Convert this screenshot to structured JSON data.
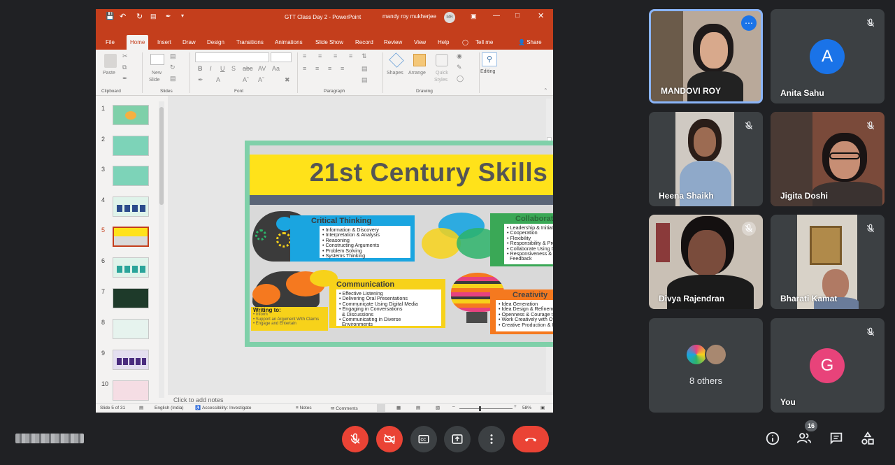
{
  "powerpoint": {
    "title": "GTT Class Day 2  -  PowerPoint",
    "user": "mandy roy mukherjee",
    "user_initials": "MR",
    "tabs": [
      "File",
      "Home",
      "Insert",
      "Draw",
      "Design",
      "Transitions",
      "Animations",
      "Slide Show",
      "Record",
      "Review",
      "View",
      "Help"
    ],
    "tell_me": "Tell me",
    "share": "Share",
    "ribbon": {
      "paste": "Paste",
      "new_slide": "New",
      "new_slide2": "Slide",
      "shapes": "Shapes",
      "arrange": "Arrange",
      "quick": "Quick",
      "styles": "Styles",
      "editing": "Editing",
      "groups": [
        "Clipboard",
        "Slides",
        "Font",
        "Paragraph",
        "Drawing"
      ]
    },
    "thumbnail_numbers": [
      "1",
      "2",
      "3",
      "4",
      "5",
      "6",
      "7",
      "8",
      "9",
      "10"
    ],
    "notes_placeholder": "Click to add notes",
    "status": {
      "slide": "Slide 5 of 31",
      "language": "English (India)",
      "accessibility": "Accessibility: Investigate",
      "notes": "Notes",
      "comments": "Comments",
      "zoom": "58%"
    }
  },
  "slide": {
    "title": "21st Century Skills",
    "critical_thinking": {
      "heading": "Critical Thinking",
      "items": [
        "Information & Discovery",
        "Interpretation & Analysis",
        "Reasoning",
        "Constructing Arguments",
        "Problem Solving",
        "Systems Thinking"
      ]
    },
    "collaboration": {
      "heading": "Collaboration",
      "items": [
        "Leadership & Initiative",
        "Cooperation",
        "Flexibility",
        "Responsibility & Productivity",
        "Collaborate Using Digital Media",
        "Responsiveness & Constructive",
        "Feedback"
      ]
    },
    "communication": {
      "heading": "Communication",
      "items": [
        "Effective Listening",
        "Delivering Oral Presentations",
        "Communicate Using Digital Media",
        "Engaging in Conversations",
        "& Discussions",
        "Communicating in Diverse",
        "Environments"
      ]
    },
    "writing": {
      "heading": "Writing to:",
      "items": [
        "Inform",
        "Support an Argument With Claims",
        "Engage and Entertain"
      ]
    },
    "creativity": {
      "heading": "Creativity",
      "items": [
        "Idea Generation",
        "Idea Design & Refinement",
        "Openness & Courage to Explore",
        "Work Creatively with Others",
        "Creative Production & Innovation"
      ]
    }
  },
  "participants": [
    {
      "name": "MANDOVI ROY"
    },
    {
      "name": "Anita Sahu",
      "initial": "A"
    },
    {
      "name": "Heena Shaikh"
    },
    {
      "name": "Jigita Doshi"
    },
    {
      "name": "Divya Rajendran"
    },
    {
      "name": "Bharati Kamat"
    },
    {
      "name": "8 others"
    },
    {
      "name": "You",
      "initial": "G"
    }
  ],
  "people_count": "16",
  "colors": {
    "ppt_accent": "#c43e1c",
    "meet_bg": "#202124",
    "tile_bg": "#3c4043",
    "end_call": "#ea4335",
    "avatar_a": "#1a73e8",
    "avatar_g": "#e8437a"
  }
}
